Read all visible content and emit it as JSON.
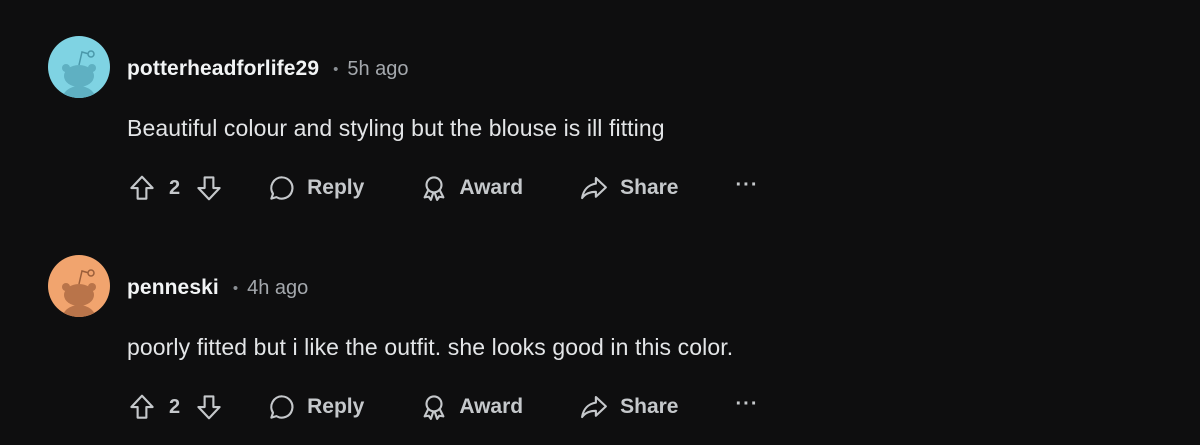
{
  "comments": [
    {
      "username": "potterheadforlife29",
      "separator": "•",
      "time": "5h ago",
      "text": "Beautiful colour and styling but the blouse is ill fitting",
      "votes": "2",
      "reply_label": "Reply",
      "award_label": "Award",
      "share_label": "Share",
      "more_label": "···",
      "avatar_bg": "#7fd3e3",
      "avatar_fg": "#5fb0c2"
    },
    {
      "username": "penneski",
      "separator": "•",
      "time": "4h ago",
      "text": "poorly fitted but i like the outfit. she looks good in this color.",
      "votes": "2",
      "reply_label": "Reply",
      "award_label": "Award",
      "share_label": "Share",
      "more_label": "···",
      "avatar_bg": "#f1a46e",
      "avatar_fg": "#b9744a"
    }
  ],
  "icons": {
    "upvote": "arrow-up-icon",
    "downvote": "arrow-down-icon",
    "reply": "chat-bubble-icon",
    "award": "award-ribbon-icon",
    "share": "share-arrow-icon"
  }
}
